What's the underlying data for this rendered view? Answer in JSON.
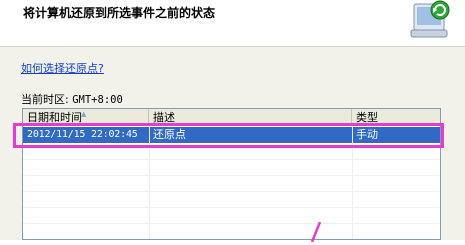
{
  "header": {
    "title": "将计算机还原到所选事件之前的状态",
    "icon": "system-restore-icon"
  },
  "help_link": "如何选择还原点?",
  "timezone": {
    "label": "当前时区:",
    "value": "GMT+8:00"
  },
  "table": {
    "columns": [
      "日期和时间",
      "描述",
      "类型"
    ],
    "rows": [
      {
        "datetime": "2012/11/15 22:02:45",
        "description": "还原点",
        "type": "手动",
        "selected": true
      }
    ]
  },
  "colors": {
    "selection": "#316ac5",
    "annotation": "#e63bd2",
    "link": "#0f3cd6"
  }
}
